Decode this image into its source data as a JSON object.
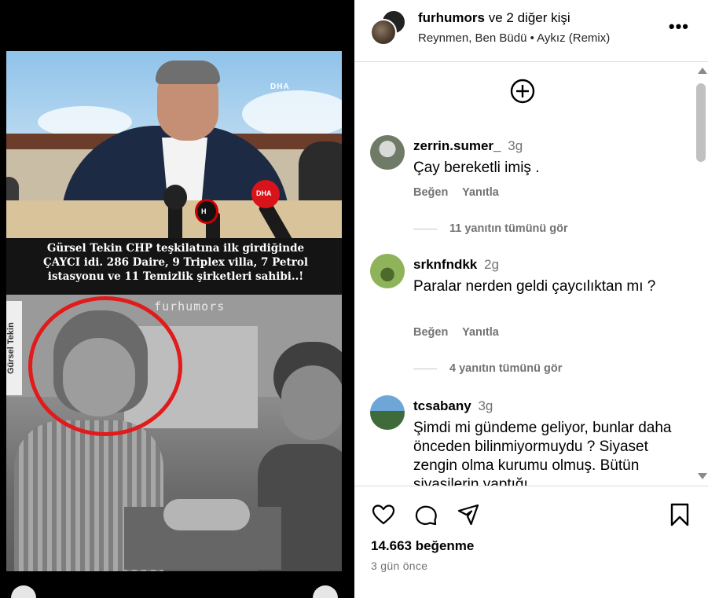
{
  "colors": {
    "accent_red": "#e11b1b",
    "muted_text": "#737373",
    "divider": "#dbdbdb"
  },
  "media": {
    "caption_lines": [
      "Gürsel Tekin CHP teşkilatına ilk girdiğinde",
      "ÇAYCI idi. 286 Daire, 9  Triplex villa, 7 Petrol",
      "istasyonu ve 11 Temizlik şirketleri sahibi..!"
    ],
    "watermark": "furhumors",
    "side_label": "Gürsel Tekin",
    "channel_logo": "DHA"
  },
  "header": {
    "username": "furhumors",
    "coauthors_suffix": "ve 2 diğer kişi",
    "audio": "Reynmen, Ben Büdü • Aykız (Remix)",
    "more_icon": "more-horizontal-icon"
  },
  "comments": [
    {
      "username": "zerrin.sumer_",
      "time": "3g",
      "text": "Çay bereketli imiş .",
      "like": "Beğen",
      "reply": "Yanıtla",
      "view_replies": "11 yanıtın tümünü gör"
    },
    {
      "username": "srknfndkk",
      "time": "2g",
      "text": "Paralar nerden geldi çaycılıktan mı ?",
      "like": "Beğen",
      "reply": "Yanıtla",
      "view_replies": "4 yanıtın tümünü gör"
    },
    {
      "username": "tcsabany",
      "time": "3g",
      "text": "Şimdi mi gündeme geliyor, bunlar daha önceden bilinmiyormuydu ? Siyaset zengin olma kurumu olmuş. Bütün siyasilerin yaptığı"
    }
  ],
  "actions": {
    "icons": [
      "heart-icon",
      "comment-icon",
      "share-icon",
      "bookmark-icon"
    ]
  },
  "likes": "14.663 beğenme",
  "date": "3 gün önce"
}
